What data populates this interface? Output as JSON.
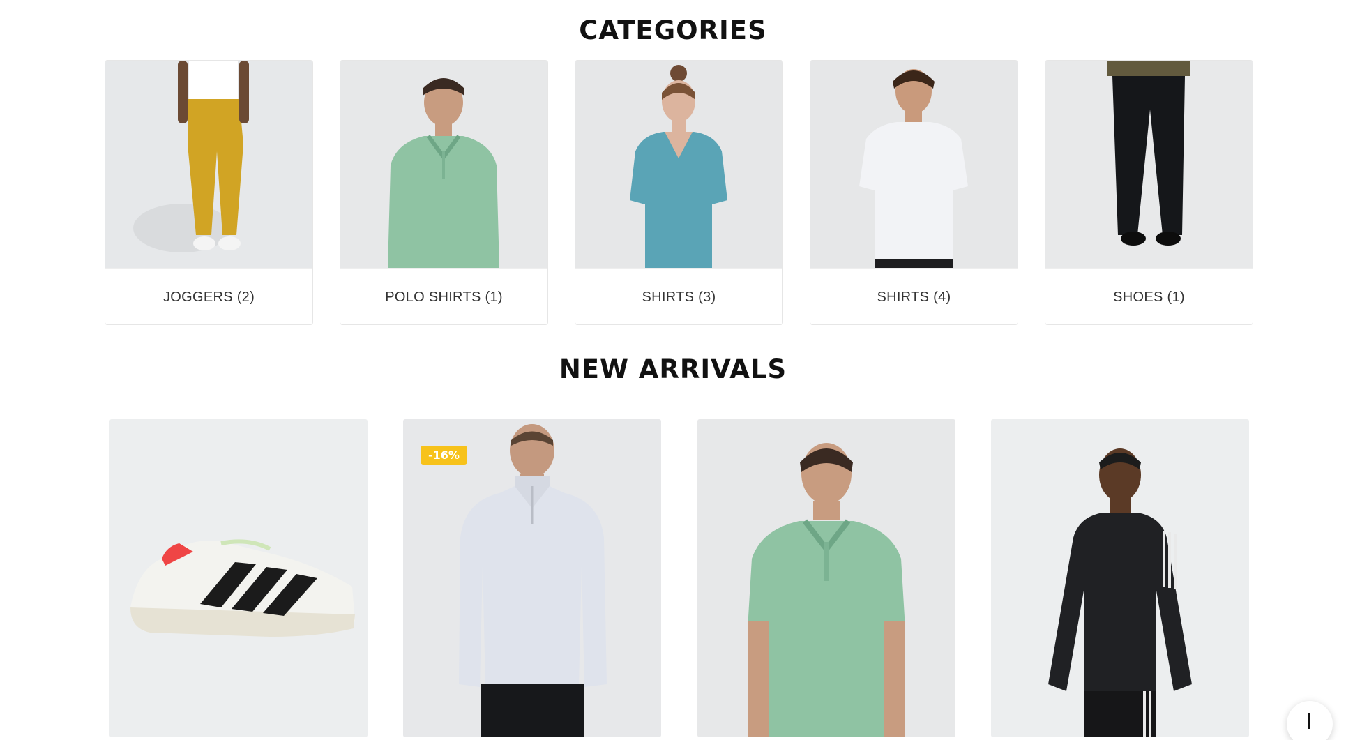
{
  "sections": {
    "categories_title": "CATEGORIES",
    "new_arrivals_title": "NEW ARRIVALS"
  },
  "categories": [
    {
      "label": "JOGGERS (2)",
      "image": "yellow-joggers-photo"
    },
    {
      "label": "POLO SHIRTS (1)",
      "image": "green-polo-photo"
    },
    {
      "label": "SHIRTS (3)",
      "image": "blue-vneck-tee-photo"
    },
    {
      "label": "SHIRTS (4)",
      "image": "white-tee-photo"
    },
    {
      "label": "SHOES (1)",
      "image": "black-trousers-photo"
    }
  ],
  "new_arrivals": [
    {
      "image": "running-shoe-photo",
      "badge": ""
    },
    {
      "image": "quarter-zip-pullover-photo",
      "badge": "-16%"
    },
    {
      "image": "green-polo-photo",
      "badge": ""
    },
    {
      "image": "black-running-longsleeve-photo",
      "badge": ""
    }
  ],
  "floating_button": {
    "icon": "cursor-bar-icon"
  },
  "colors": {
    "badge": "#f7c21b",
    "card_bg": "#eceeef",
    "title": "#111111"
  }
}
